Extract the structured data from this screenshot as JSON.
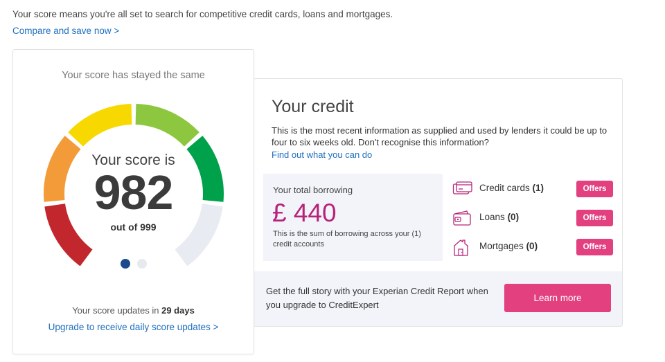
{
  "intro": {
    "text": "Your score means you're all set to search for competitive credit cards, loans and mortgages.",
    "link": "Compare and save now >"
  },
  "score": {
    "status": "Your score has stayed the same",
    "label": "Your score is",
    "value": "982",
    "max": "out of 999",
    "value_num": 982,
    "max_num": 999,
    "update_prefix": "Your score updates in",
    "update_days": "29 days",
    "upgrade_link": "Upgrade to receive daily score updates >",
    "carousel_active": 1,
    "carousel_total": 2,
    "gauge_colors": [
      "#c1272d",
      "#f29b38",
      "#f7d800",
      "#8dc63f",
      "#00a14b",
      "#e8ebf1"
    ],
    "gauge_filled_segments": 5
  },
  "credit": {
    "title": "Your credit",
    "description": "This is the most recent information as supplied and used by lenders it could be up to four to six weeks old. Don't recognise this information?",
    "link": "Find out what you can do",
    "borrowing": {
      "label": "Your total borrowing",
      "amount": "£ 440",
      "note": "This is the sum of borrowing across your (1) credit accounts"
    },
    "accounts": [
      {
        "name": "Credit cards",
        "count": "(1)",
        "icon": "credit-card-icon",
        "action": "Offers"
      },
      {
        "name": "Loans",
        "count": "(0)",
        "icon": "wallet-icon",
        "action": "Offers"
      },
      {
        "name": "Mortgages",
        "count": "(0)",
        "icon": "house-icon",
        "action": "Offers"
      }
    ],
    "footer": {
      "text": "Get the full story with your Experian Credit Report when you upgrade to CreditExpert",
      "button": "Learn more"
    }
  },
  "colors": {
    "link": "#1d6fbf",
    "accent_pink": "#e2407f",
    "amount_magenta": "#b5237a",
    "panel_bg": "#f2f4f9",
    "carousel_active": "#1b4a8d"
  }
}
